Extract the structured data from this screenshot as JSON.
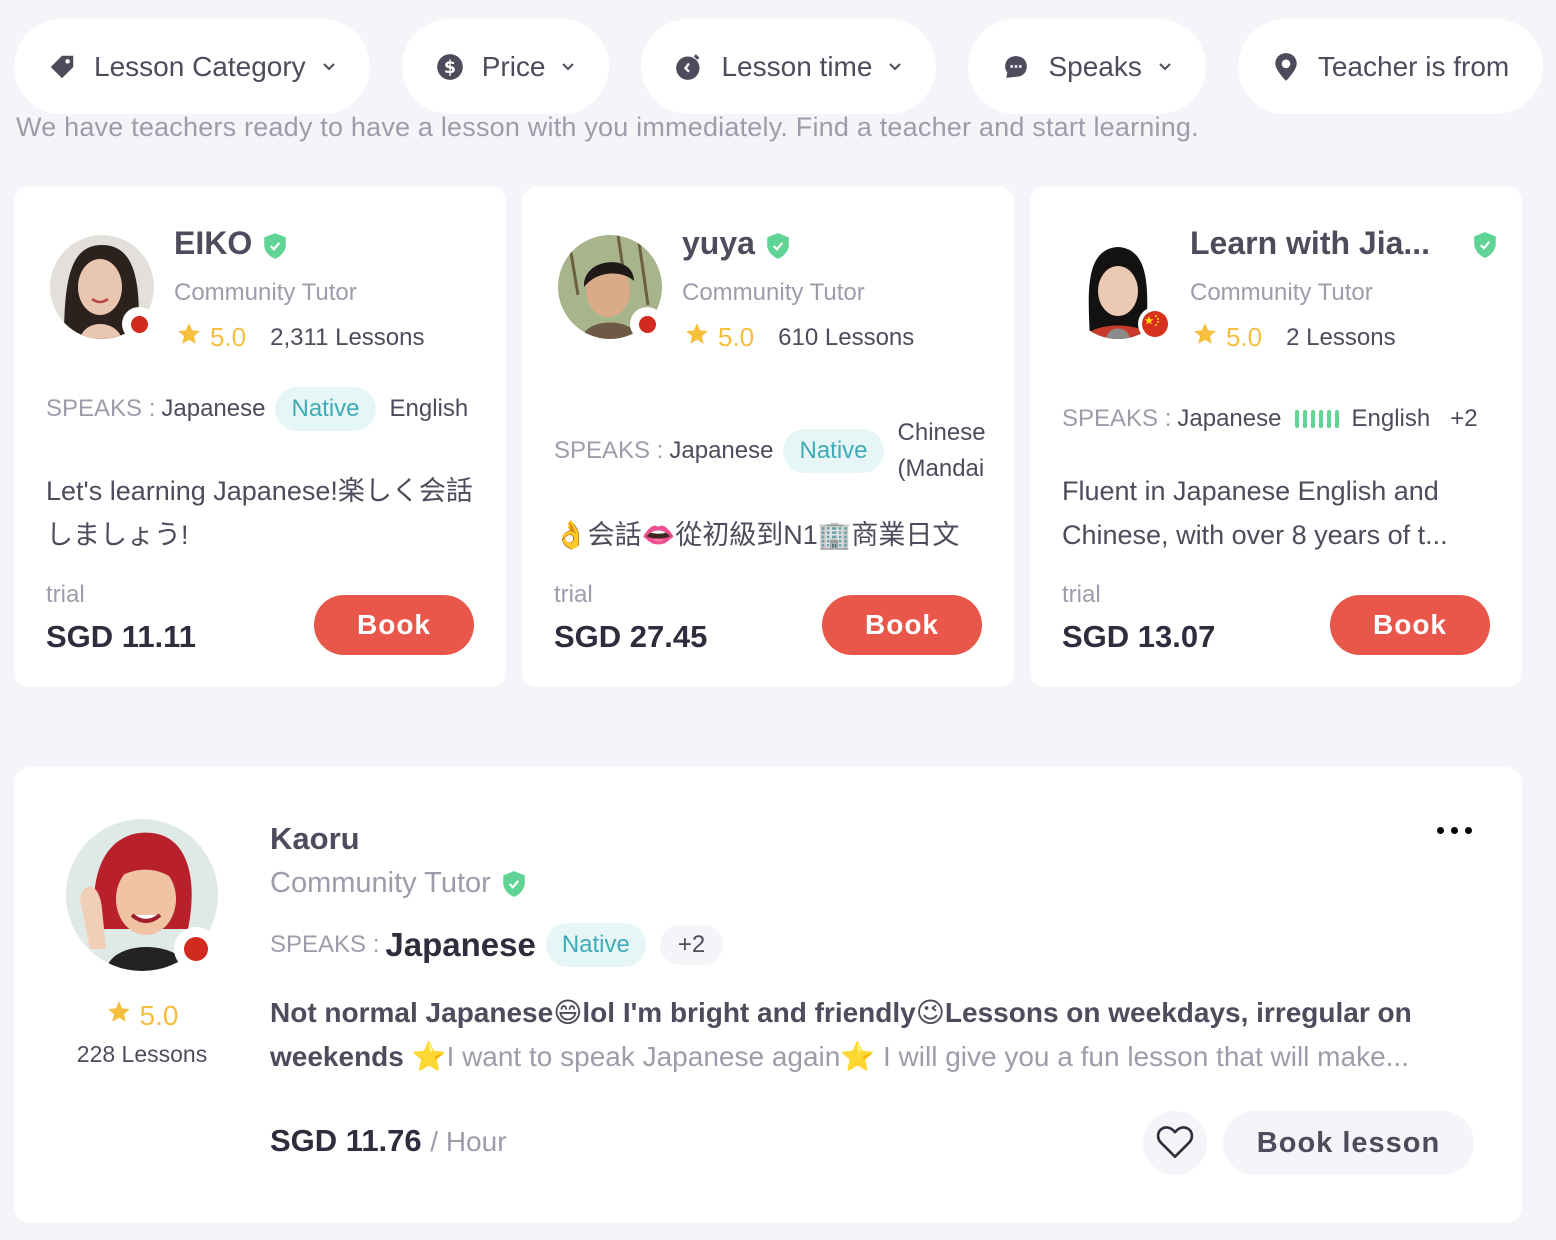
{
  "subtitle": "We have teachers ready to have a lesson with you immediately. Find a teacher and start learning.",
  "filters": [
    {
      "label": "Lesson Category",
      "icon": "tag-icon"
    },
    {
      "label": "Price",
      "icon": "dollar-icon"
    },
    {
      "label": "Lesson time",
      "icon": "clock-icon"
    },
    {
      "label": "Speaks",
      "icon": "chat-icon"
    },
    {
      "label": "Teacher is from",
      "icon": "location-pin-icon"
    }
  ],
  "tutors": [
    {
      "name": "EIKO",
      "type": "Community Tutor",
      "rating": "5.0",
      "lessons": "2,311 Lessons",
      "flag": "Japan",
      "speaks_label": "SPEAKS :",
      "primary_language": "Japanese",
      "primary_level": "Native",
      "other_language": "English",
      "description": "Let's learning Japanese!楽しく会話しましょう!",
      "trial_label": "trial",
      "price": "SGD 11.11",
      "book_label": "Book"
    },
    {
      "name": "yuya",
      "type": "Community Tutor",
      "rating": "5.0",
      "lessons": "610 Lessons",
      "flag": "Japan",
      "speaks_label": "SPEAKS :",
      "primary_language": "Japanese",
      "primary_level": "Native",
      "other_language": "Chinese (Mandai",
      "description": "👌会話👄從初級到N1🏢商業日文",
      "trial_label": "trial",
      "price": "SGD 27.45",
      "book_label": "Book"
    },
    {
      "name": "Learn with Jia...",
      "type": "Community Tutor",
      "rating": "5.0",
      "lessons": "2 Lessons",
      "flag": "China",
      "speaks_label": "SPEAKS :",
      "primary_language": "Japanese",
      "primary_level_bars": 6,
      "other_language": "English",
      "more_languages": "+2",
      "description": "Fluent in Japanese English and Chinese, with over 8 years of t...",
      "trial_label": "trial",
      "price": "SGD 13.07",
      "book_label": "Book"
    }
  ],
  "featured": {
    "name": "Kaoru",
    "type": "Community Tutor",
    "rating": "5.0",
    "lessons": "228 Lessons",
    "flag": "Japan",
    "speaks_label": "SPEAKS :",
    "primary_language": "Japanese",
    "primary_level": "Native",
    "more_languages": "+2",
    "description_bold": "Not normal Japanese😄lol I'm bright and friendly😉Lessons on weekdays, irregular on weekends ",
    "description_light": "⭐I want to speak Japanese again⭐ I will give you a fun lesson that will make...",
    "price": "SGD 11.76",
    "price_unit": "/ Hour",
    "book_label": "Book lesson"
  },
  "colors": {
    "accent": "#e9574a",
    "star": "#f5be3c",
    "verified": "#5fd494",
    "native_badge_text": "#3fabb5",
    "background": "#f4f5f9"
  }
}
